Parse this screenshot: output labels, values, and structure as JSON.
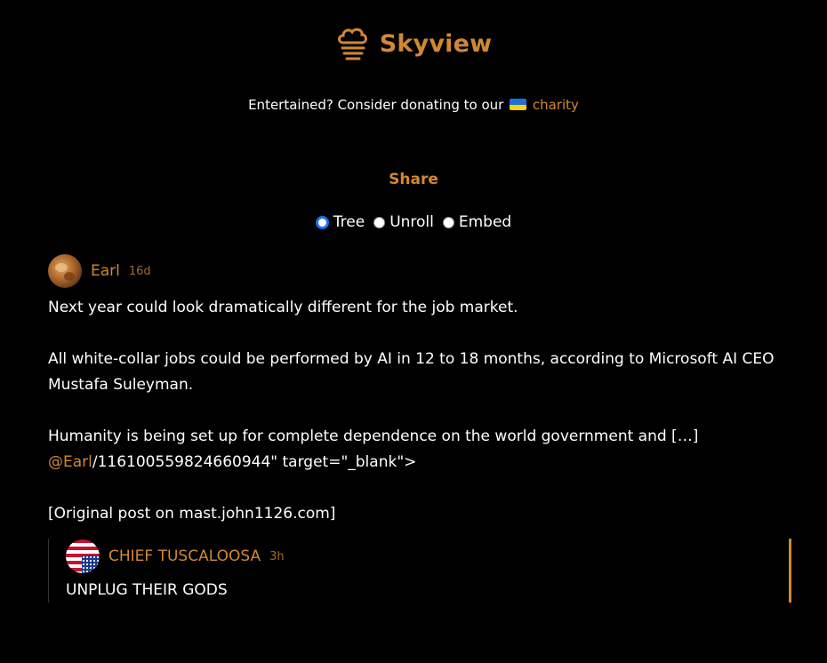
{
  "app": {
    "brand": "Skyview",
    "logo_icon": "cloud-stack-icon",
    "accent_color": "#d18833"
  },
  "donate": {
    "text": "Entertained? Consider donating to our",
    "flag_icon": "ukraine-flag-icon",
    "link_label": "charity"
  },
  "share": {
    "title": "Share",
    "options": [
      {
        "label": "Tree",
        "checked": true
      },
      {
        "label": "Unroll",
        "checked": false
      },
      {
        "label": "Embed",
        "checked": false
      }
    ]
  },
  "post": {
    "author": "Earl",
    "time": "16d",
    "paragraphs": [
      "Next year could look dramatically different for the job market.",
      "All white-collar jobs could be performed by AI in 12 to 18 months, according to Microsoft AI CEO Mustafa Suleyman.",
      "Humanity is being set up for complete dependence on the world government and […]"
    ],
    "mention": "@Earl",
    "trailing": "/116100559824660944\" target=\"_blank\">",
    "source": "[Original post on mast.john1126.com]"
  },
  "reply": {
    "author": "CHIEF TUSCALOOSA",
    "time": "3h",
    "text": "UNPLUG THEIR GODS"
  }
}
